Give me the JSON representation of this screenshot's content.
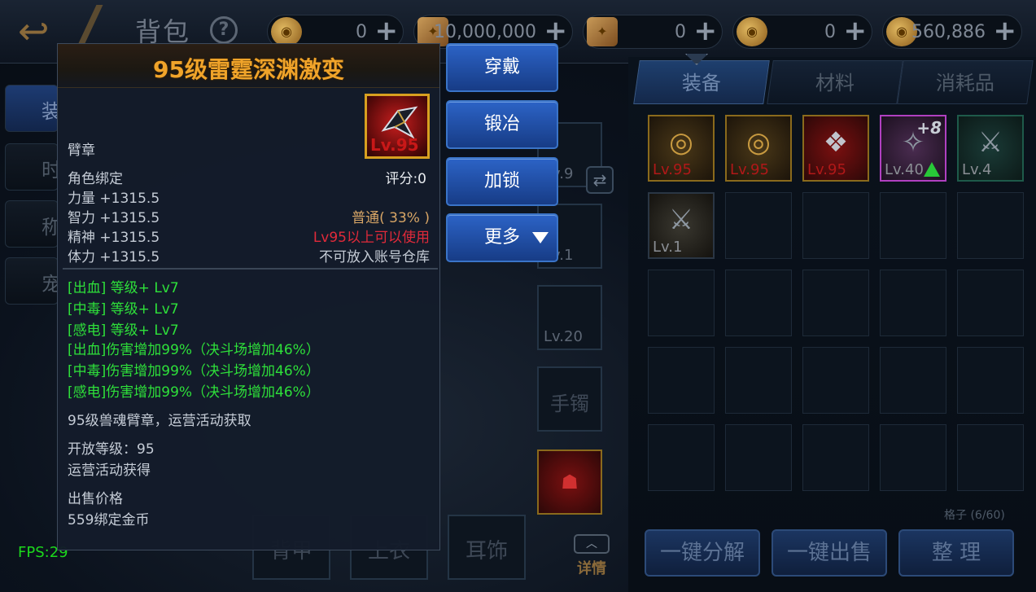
{
  "topbar": {
    "title": "背包",
    "help": "?",
    "currencies": [
      {
        "icon": "gold-coin-icon",
        "value": "0"
      },
      {
        "icon": "scroll-icon",
        "value": "10,000,000"
      },
      {
        "icon": "locked-scroll-icon",
        "value": "0"
      },
      {
        "icon": "gold-coin-icon",
        "value": "0"
      },
      {
        "icon": "locked-gold-coin-icon",
        "value": "560,886"
      }
    ]
  },
  "sidebar": {
    "items": [
      {
        "label": "装"
      },
      {
        "label": "时"
      },
      {
        "label": "称"
      },
      {
        "label": "宠"
      }
    ]
  },
  "equip_slots": {
    "slots": [
      {
        "level": "Lv.9"
      },
      {
        "level": "Lv.1"
      },
      {
        "level": "Lv.20"
      },
      {
        "label": "手镯"
      },
      {
        "level": ""
      }
    ],
    "bottom": [
      {
        "label": "背甲"
      },
      {
        "label": "上衣"
      },
      {
        "label": "耳饰"
      }
    ],
    "detail_label": "详情"
  },
  "inventory": {
    "tabs": [
      {
        "label": "装备"
      },
      {
        "label": "材料"
      },
      {
        "label": "消耗品"
      }
    ],
    "items": [
      {
        "level": "Lv.95"
      },
      {
        "level": "Lv.95"
      },
      {
        "level": "Lv.95"
      },
      {
        "level": "Lv.40",
        "plus": "+8"
      },
      {
        "level": "Lv.4"
      },
      {
        "level": "Lv.1"
      }
    ],
    "grid_count": "格子 (6/60)",
    "buttons": {
      "decompose": "一键分解",
      "sell": "一键出售",
      "sort": "整 理"
    }
  },
  "tooltip": {
    "title": "95级雷霆深渊激变",
    "icon_level": "Lv.95",
    "type": "臂章",
    "binding": "角色绑定",
    "score": "评分:0",
    "stats": [
      "力量 +1315.5",
      "智力 +1315.5",
      "精神 +1315.5",
      "体力 +1315.5"
    ],
    "rarity": "普通( 33% )",
    "level_req": "Lv95以上可以使用",
    "storage": "不可放入账号仓库",
    "bonuses": [
      "[出血] 等级+ Lv7",
      "[中毒] 等级+ Lv7",
      "[感电] 等级+ Lv7",
      "[出血]伤害增加99%（决斗场增加46%）",
      "[中毒]伤害增加99%（决斗场增加46%）",
      "[感电]伤害增加99%（决斗场增加46%）"
    ],
    "description": "95级兽魂臂章，运营活动获取",
    "open_level": "开放等级：95",
    "source": "运营活动获得",
    "sell_label": "出售价格",
    "sell_price": "559绑定金币"
  },
  "actions": {
    "equip": "穿戴",
    "forge": "锻冶",
    "lock": "加锁",
    "more": "更多"
  },
  "fps": "FPS:29"
}
